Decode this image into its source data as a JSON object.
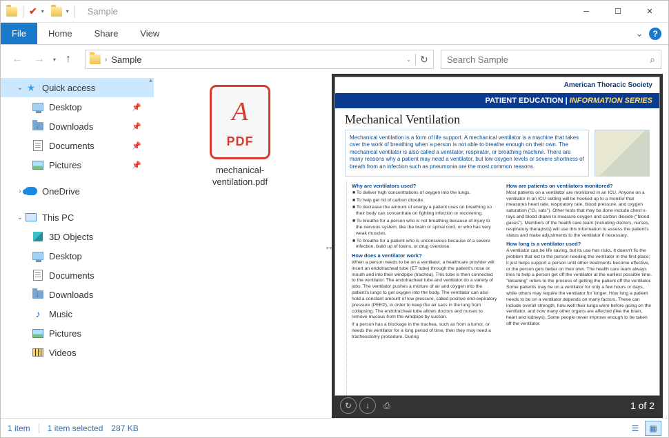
{
  "window": {
    "title": "Sample"
  },
  "ribbon": {
    "file": "File",
    "home": "Home",
    "share": "Share",
    "view": "View"
  },
  "address": {
    "folder": "Sample"
  },
  "search": {
    "placeholder": "Search Sample"
  },
  "nav": {
    "quick_access": "Quick access",
    "desktop": "Desktop",
    "downloads": "Downloads",
    "documents": "Documents",
    "pictures": "Pictures",
    "onedrive": "OneDrive",
    "this_pc": "This PC",
    "3d_objects": "3D Objects",
    "music": "Music",
    "videos": "Videos"
  },
  "file": {
    "name": "mechanical-ventilation.pdf",
    "icon_label": "PDF"
  },
  "status": {
    "count": "1 item",
    "selected": "1 item selected",
    "size": "287 KB"
  },
  "preview": {
    "org": "American Thoracic Society",
    "bar_left": "PATIENT EDUCATION",
    "bar_right": "INFORMATION SERIES",
    "title": "Mechanical Ventilation",
    "intro": "Mechanical ventilation is a form of life support. A mechanical ventilator is a machine that takes over the work of breathing when a person is not able to breathe enough on their own. The mechanical ventilator is also called a ventilator, respirator, or breathing machine. There are many reasons why a patient may need a ventilator, but low oxygen levels or severe shortness of breath from an infection such as pneumonia are the most common reasons.",
    "h1": "Why are ventilators used?",
    "b1": "■ To deliver high concentrations of oxygen into the lungs.",
    "b2": "■ To help get rid of carbon dioxide.",
    "b3": "■ To decrease the amount of energy a patient uses on breathing so their body can concentrate on fighting infection or recovering.",
    "b4": "■ To breathe for a person who is not breathing because of injury to the nervous system, like the brain or spinal cord, or who has very weak muscles.",
    "b5": "■ To breathe for a patient who is unconscious because of a severe infection, build up of toxins, or drug overdose.",
    "h2": "How does a ventilator work?",
    "p2": "When a person needs to be on a ventilator, a healthcare provider will insert an endotracheal tube (ET tube) through the patient's nose or mouth and into their windpipe (trachea). This tube is then connected to the ventilator. The endotracheal tube and ventilator do a variety of jobs. The ventilator pushes a mixture of air and oxygen into the patient's lungs to get oxygen into the body. The ventilator can also hold a constant amount of low pressure, called positive end-expiratory pressure (PEEP), in order to keep the air sacs in the lung from collapsing. The endotracheal tube allows doctors and nurses to remove mucous from the windpipe by suction.",
    "p2b": "If a person has a blockage in the trachea, such as from a tumor, or needs the ventilator for a long period of time, then they may need a tracheostomy procedure. During",
    "h3": "How are patients on ventilators monitored?",
    "p3": "Most patients on a ventilator are monitored in an ICU. Anyone on a ventilator in an ICU setting will be hooked up to a monitor that measures heart rate, respiratory rate, blood pressure, and oxygen saturation (\"O₂ sats\"). Other tests that may be done include chest x-rays and blood drawn to measure oxygen and carbon dioxide (\"blood gases\"). Members of the health care team (including doctors, nurses, respiratory therapists) will use this information to assess the patient's status and make adjustments to the ventilator if necessary.",
    "h4": "How long is a ventilator used?",
    "p4": "A ventilator can be life saving, but its use has risks. It doesn't fix the problem that led to the person needing the ventilator in the first place; it just helps support a person until other treatments become effective, or the person gets better on their own. The health care team always tries to help a person get off the ventilator at the earliest possible time. \"Weaning\" refers to the process of getting the patient off the ventilator. Some patients may be on a ventilator for only a few hours or days, while others may require the ventilator for longer. How long a patient needs to be on a ventilator depends on many factors. These can include overall strength, how well their lungs were before going on the ventilator, and how many other organs are affected (like the brain, heart and kidneys). Some people never improve enough to be taken off the ventilator.",
    "page_indicator": "1 of 2"
  }
}
